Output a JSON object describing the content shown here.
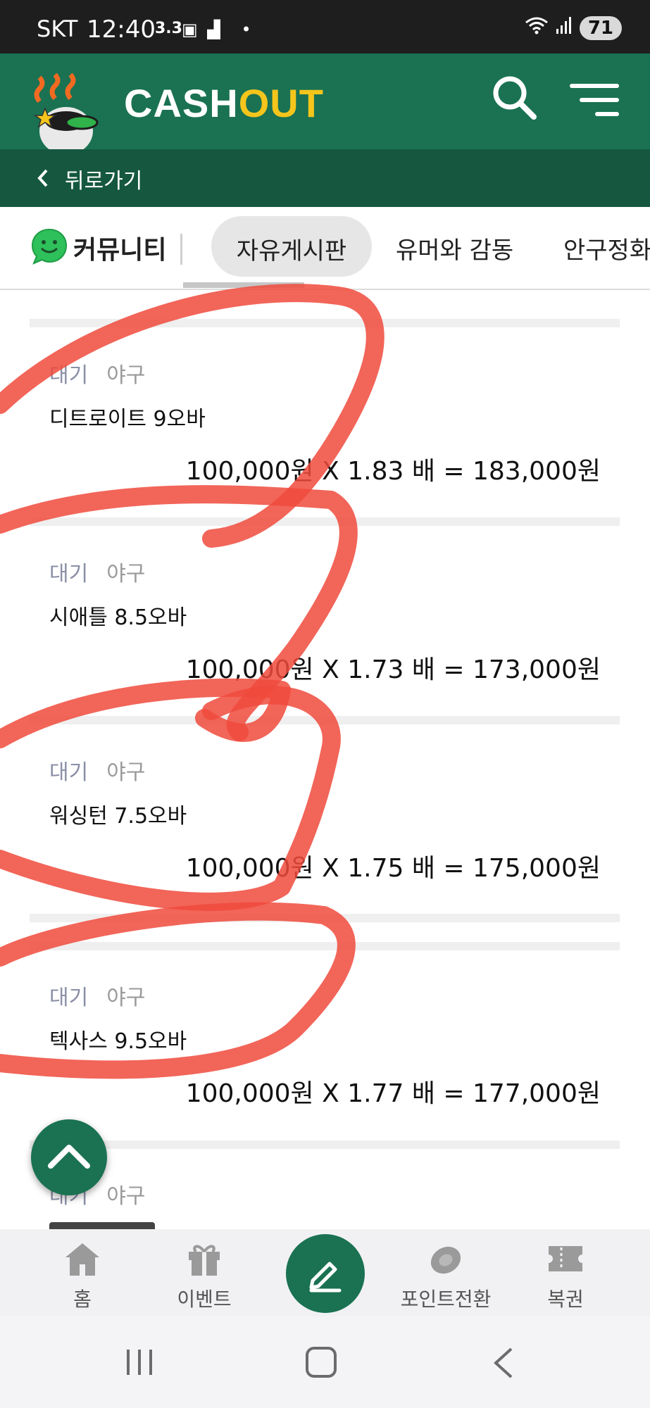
{
  "status_bar": {
    "carrier": "SKT",
    "time": "12:40",
    "speed_value": "3.3",
    "battery": "71"
  },
  "header": {
    "brand_part1": "CASH",
    "brand_part2": "OUT",
    "back_label": "뒤로가기"
  },
  "community": {
    "label": "커뮤니티",
    "tabs": [
      {
        "label": "자유게시판",
        "active": true
      },
      {
        "label": "유머와 감동",
        "active": false
      },
      {
        "label": "안구정화",
        "active": false
      }
    ]
  },
  "posts": [
    {
      "status": "대기",
      "sport": "야구",
      "title": "디트로이트 9오바",
      "calc": "100,000원 X 1.83 배 = 183,000원"
    },
    {
      "status": "대기",
      "sport": "야구",
      "title": "시애틀 8.5오바",
      "calc": "100,000원 X 1.73 배 = 173,000원"
    },
    {
      "status": "대기",
      "sport": "야구",
      "title": "워싱턴 7.5오바",
      "calc": "100,000원 X 1.75 배 = 175,000원"
    },
    {
      "status": "대기",
      "sport": "야구",
      "title": "텍사스 9.5오바",
      "calc": "100,000원 X 1.77 배 = 177,000원"
    },
    {
      "status": "대기",
      "sport": "야구",
      "title": "",
      "calc": ""
    }
  ],
  "bottom_nav": {
    "home": "홈",
    "event": "이벤트",
    "points": "포인트전환",
    "lottery": "복권"
  },
  "colors": {
    "primary_green": "#1a7252",
    "dark_green": "#15583f",
    "accent_yellow": "#f5c51c",
    "scribble_red": "#f04a3c"
  }
}
